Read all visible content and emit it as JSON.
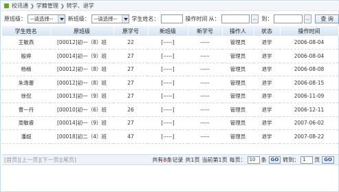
{
  "breadcrumb": [
    "校讯通",
    "学籍管理",
    "转学、退学"
  ],
  "filters": {
    "orig_class_label": "原班级：",
    "orig_class_value": "--请选择--",
    "new_class_label": "新班级：",
    "new_class_value": "--请选择--",
    "student_name_label": "学生姓名：",
    "op_time_label": "操作时间",
    "from_label": "从：",
    "to_label": "到：",
    "dots": "...",
    "query_button": "查 询"
  },
  "table": {
    "columns": [
      "学生姓名",
      "原班级",
      "原学号",
      "新班级",
      "新学号",
      "操作人",
      "状态",
      "操作时间"
    ],
    "rows": [
      [
        "王敏燕",
        "[00012]初一（8）班",
        "22",
        "[-----]",
        "-----",
        "管理员",
        "退学",
        "2006-08-04"
      ],
      [
        "殷婷",
        "[00014]初一（9）班",
        "27",
        "[-----]",
        "-----",
        "管理员",
        "退学",
        "2006-08-04"
      ],
      [
        "杨楠",
        "[00012]初一（8）班",
        "27",
        "[-----]",
        "-----",
        "管理员",
        "退学",
        "2006-08-08"
      ],
      [
        "朱逸蕾",
        "[00012]初一（8）班",
        "27",
        "[-----]",
        "-----",
        "管理员",
        "退学",
        "2006-08-15"
      ],
      [
        "徐侃",
        "[00013]初一（9）班",
        "27",
        "[-----]",
        "-----",
        "管理员",
        "退学",
        "2006-11-09"
      ],
      [
        "曹一丹",
        "[00010]初一（6）班",
        "26",
        "[-----]",
        "-----",
        "管理员",
        "退学",
        "2006-12-11"
      ],
      [
        "周敏睿",
        "[00014]初一（9）班",
        "27",
        "[-----]",
        "-----",
        "管理员",
        "退学",
        "2007-06-02"
      ],
      [
        "潘超",
        "[00018]初二（4）班",
        "47",
        "[-----]",
        "-----",
        "管理员",
        "退学",
        "2007-08-22"
      ]
    ]
  },
  "pager": {
    "first": "[首页]",
    "prev": "[上一页]",
    "next": "[下一页]",
    "last": "[尾页]",
    "total_prefix": "共有",
    "total": "8",
    "total_suffix": "条记录",
    "pages_text": "共1页",
    "current_prefix": "当前第",
    "current": "1",
    "current_suffix": "页",
    "per_page_label": "每页：",
    "per_page": "10",
    "per_page_unit": "条",
    "go1": "GO",
    "jump_label": "转到：",
    "jump_value": "1",
    "jump_unit": "页",
    "go2": "GO"
  }
}
